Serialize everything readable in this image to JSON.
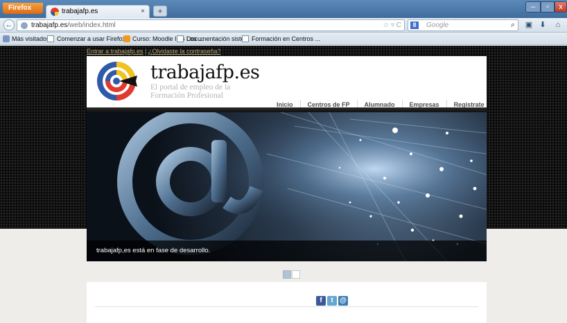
{
  "browser": {
    "menu_button": "Firefox",
    "tab_title": "trabajafp.es",
    "tab_close": "×",
    "new_tab": "+",
    "win_min": "–",
    "win_max": "▫",
    "win_close": "x",
    "url_domain": "trabajafp.es",
    "url_path": "/web/index.html",
    "url_tools": "☆ ▿ C",
    "search_engine": "8",
    "search_placeholder": "Google",
    "search_go": "⌕",
    "back": "←",
    "bookmarks": [
      {
        "label": "Más visitados",
        "icon": "bookmarks-icon"
      },
      {
        "label": "Comenzar a usar Firefox",
        "icon": "page-icon"
      },
      {
        "label": "Curso: Moodle IES Los ...",
        "icon": "moodle-icon"
      },
      {
        "label": "Documentación siste...",
        "icon": "page-icon"
      },
      {
        "label": "Formación en Centros ...",
        "icon": "page-icon"
      }
    ]
  },
  "site": {
    "login_link": "Entrar a trabajafp.es",
    "separator": "|",
    "forgot_link": "¿Olvidaste la contraseña?",
    "brand": "trabajafp.es",
    "tagline_line1": "El portal de empleo de la",
    "tagline_line2": "Formación Profesional",
    "menu": [
      "Inicio",
      "Centros de FP",
      "Alumnado",
      "Empresas",
      "Registrate"
    ],
    "hero_caption": "trabajafp,es está en fase de desarrollo.",
    "slider_pages": 2,
    "slider_active": 1,
    "social": [
      {
        "name": "facebook-icon",
        "glyph": "f"
      },
      {
        "name": "twitter-icon",
        "glyph": "t"
      },
      {
        "name": "email-icon",
        "glyph": "@"
      }
    ]
  },
  "colors": {
    "page_bg": "#eeedea",
    "dark_band": "#0d0d0d",
    "link": "#b7a675",
    "menu_text": "#4c4c4c"
  }
}
